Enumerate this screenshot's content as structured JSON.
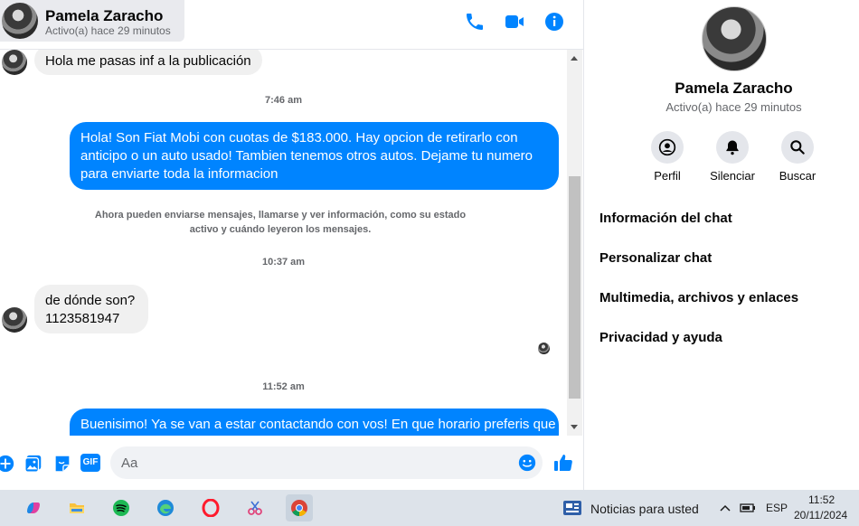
{
  "header": {
    "name": "Pamela Zaracho",
    "status": "Activo(a) hace 29 minutos",
    "icons": [
      "phone-icon",
      "video-icon",
      "info-icon"
    ]
  },
  "messages": {
    "m1": "Hola me pasas inf a la publicación",
    "t1": "7:46 am",
    "m2": "Hola! Son Fiat Mobi con cuotas de $183.000. Hay opcion de retirarlo con anticipo o un auto usado! Tambien tenemos otros autos. Dejame tu numero para enviarte toda la informacion",
    "notice": "Ahora pueden enviarse mensajes, llamarse y ver información, como su estado activo y cuándo leyeron los mensajes.",
    "t2": "10:37 am",
    "m3_line1": "de dónde son?",
    "m3_line2": "1123581947",
    "t3": "11:52 am",
    "m4": "Buenisimo! Ya se van a estar contactando con vos! En que horario preferis que"
  },
  "composer": {
    "placeholder": "Aa",
    "icons": [
      "plus-icon",
      "image-icon",
      "sticker-icon",
      "gif-icon",
      "emoji-icon",
      "like-icon"
    ],
    "gif_label": "GIF"
  },
  "info": {
    "name": "Pamela Zaracho",
    "status": "Activo(a) hace 29 minutos",
    "actions": [
      {
        "label": "Perfil",
        "icon": "profile-icon"
      },
      {
        "label": "Silenciar",
        "icon": "bell-icon"
      },
      {
        "label": "Buscar",
        "icon": "search-icon"
      }
    ],
    "sections": [
      "Información del chat",
      "Personalizar chat",
      "Multimedia, archivos y enlaces",
      "Privacidad y ayuda"
    ]
  },
  "taskbar": {
    "apps": [
      "copilot-icon",
      "file-explorer-icon",
      "spotify-icon",
      "edge-icon",
      "opera-icon",
      "snipping-tool-icon",
      "chrome-icon"
    ],
    "news": "Noticias para usted",
    "lang": "ESP",
    "time": "11:52",
    "date": "20/11/2024"
  },
  "colors": {
    "accent": "#0084ff",
    "incoming_bubble": "#f0f0f0",
    "taskbar": "#dde3ea"
  }
}
